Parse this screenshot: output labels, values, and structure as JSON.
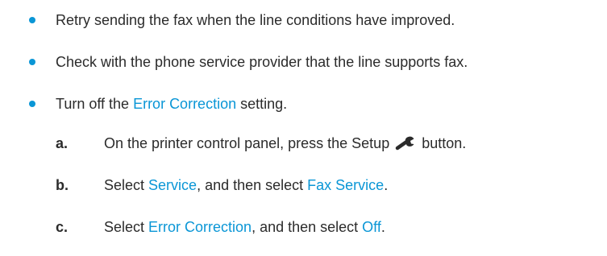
{
  "colors": {
    "accent": "#0a96d6",
    "text": "#2b2b2b"
  },
  "bullets": [
    {
      "text": "Retry sending the fax when the line conditions have improved."
    },
    {
      "text": "Check with the phone service provider that the line supports fax."
    },
    {
      "pre": "Turn off the ",
      "link": "Error Correction",
      "post": " setting."
    }
  ],
  "steps": [
    {
      "letter": "a.",
      "pre": "On the printer control panel, press the Setup",
      "icon": "wrench-icon",
      "post": "button."
    },
    {
      "letter": "b.",
      "pre": "Select ",
      "link1": "Service",
      "mid": ", and then select ",
      "link2": "Fax Service",
      "post": "."
    },
    {
      "letter": "c.",
      "pre": "Select ",
      "link1": "Error Correction",
      "mid": ", and then select ",
      "link2": "Off",
      "post": "."
    }
  ]
}
